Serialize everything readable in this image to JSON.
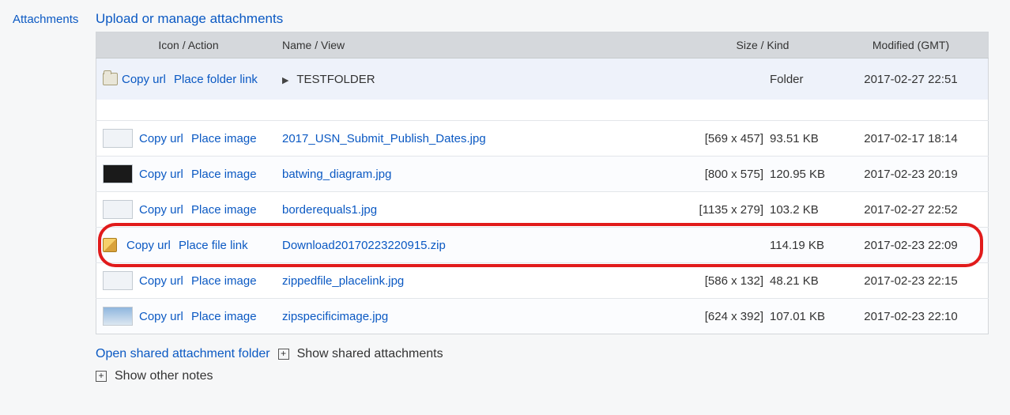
{
  "sidebar_label": "Attachments",
  "heading": "Upload or manage attachments",
  "columns": {
    "icon": "Icon / Action",
    "name": "Name / View",
    "size": "Size / Kind",
    "modified": "Modified (GMT)"
  },
  "copy_url_label": "Copy url",
  "folder_row": {
    "place_label": "Place folder link",
    "name": "TESTFOLDER",
    "kind": "Folder",
    "modified": "2017-02-27 22:51"
  },
  "rows": [
    {
      "thumb": "light",
      "place_label": "Place image",
      "name": "2017_USN_Submit_Publish_Dates.jpg",
      "dims": "[569 x 457]",
      "size": "93.51 KB",
      "modified": "2017-02-17 18:14",
      "highlight": false
    },
    {
      "thumb": "dark",
      "place_label": "Place image",
      "name": "batwing_diagram.jpg",
      "dims": "[800 x 575]",
      "size": "120.95 KB",
      "modified": "2017-02-23 20:19",
      "highlight": false
    },
    {
      "thumb": "light",
      "place_label": "Place image",
      "name": "borderequals1.jpg",
      "dims": "[1135 x 279]",
      "size": "103.2 KB",
      "modified": "2017-02-27 22:52",
      "highlight": false
    },
    {
      "thumb": "zip",
      "place_label": "Place file link",
      "name": "Download20170223220915.zip",
      "dims": "",
      "size": "114.19 KB",
      "modified": "2017-02-23 22:09",
      "highlight": true
    },
    {
      "thumb": "light",
      "place_label": "Place image",
      "name": "zippedfile_placelink.jpg",
      "dims": "[586 x 132]",
      "size": "48.21 KB",
      "modified": "2017-02-23 22:15",
      "highlight": false
    },
    {
      "thumb": "sky",
      "place_label": "Place image",
      "name": "zipspecificimage.jpg",
      "dims": "[624 x 392]",
      "size": "107.01 KB",
      "modified": "2017-02-23 22:10",
      "highlight": false
    }
  ],
  "open_shared": "Open shared attachment folder",
  "show_shared": "Show shared attachments",
  "show_other": "Show other notes"
}
